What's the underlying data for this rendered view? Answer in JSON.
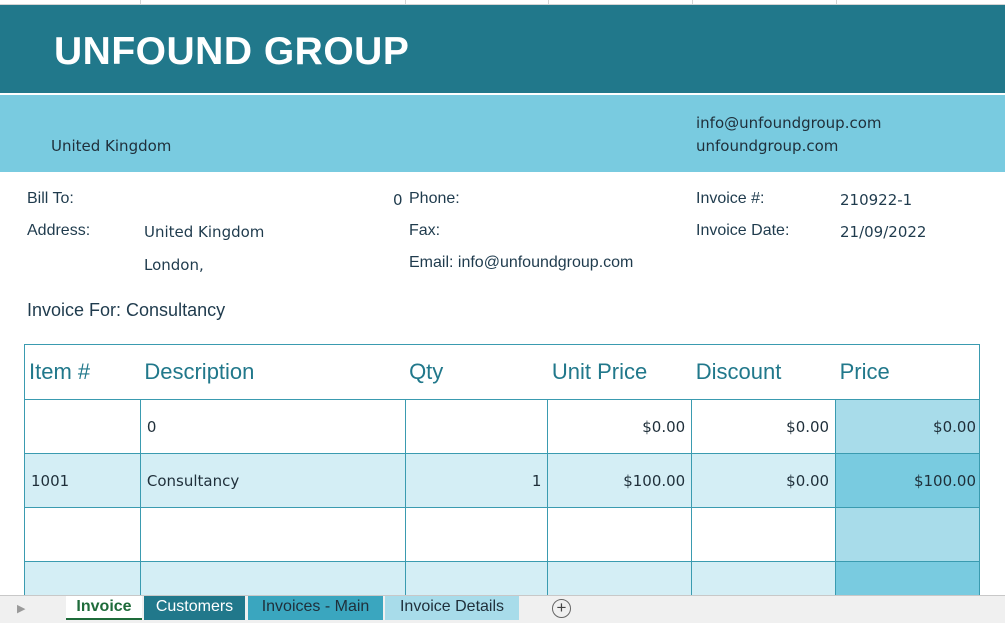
{
  "header": {
    "company_name": "UNFOUND GROUP",
    "country": "United Kingdom",
    "email": "info@unfoundgroup.com",
    "website": "unfoundgroup.com"
  },
  "bill": {
    "bill_to_label": "Bill To:",
    "bill_to_value": "0",
    "address_label": "Address:",
    "address_line1": "United Kingdom",
    "address_line2": "London,",
    "phone_label": "Phone:",
    "fax_label": "Fax:",
    "email_label": "Email: info@unfoundgroup.com",
    "invoice_no_label": "Invoice #:",
    "invoice_no": "210922-1",
    "invoice_date_label": "Invoice Date:",
    "invoice_date": "21/09/2022",
    "invoice_for": "Invoice For: Consultancy"
  },
  "table": {
    "headers": [
      "Item #",
      "Description",
      "Qty",
      "Unit Price",
      "Discount",
      "Price"
    ],
    "rows": [
      {
        "item": "",
        "description": "0",
        "qty": "",
        "unit_price": "$0.00",
        "discount": "$0.00",
        "price": "$0.00"
      },
      {
        "item": "1001",
        "description": "Consultancy",
        "qty": "1",
        "unit_price": "$100.00",
        "discount": "$0.00",
        "price": "$100.00"
      },
      {
        "item": "",
        "description": "",
        "qty": "",
        "unit_price": "",
        "discount": "",
        "price": ""
      },
      {
        "item": "",
        "description": "",
        "qty": "",
        "unit_price": "",
        "discount": "",
        "price": ""
      }
    ]
  },
  "tabs": {
    "invoice": "Invoice",
    "customers": "Customers",
    "invoices_main": "Invoices - Main",
    "invoice_details": "Invoice Details",
    "add_icon": "plus-circle-icon",
    "scroll_icon": "triangle-right-icon"
  },
  "colors": {
    "header_dark": "#21788b",
    "header_light": "#79cbe0",
    "row_alt": "#d4eef5",
    "price_col": "#a8dcea"
  }
}
